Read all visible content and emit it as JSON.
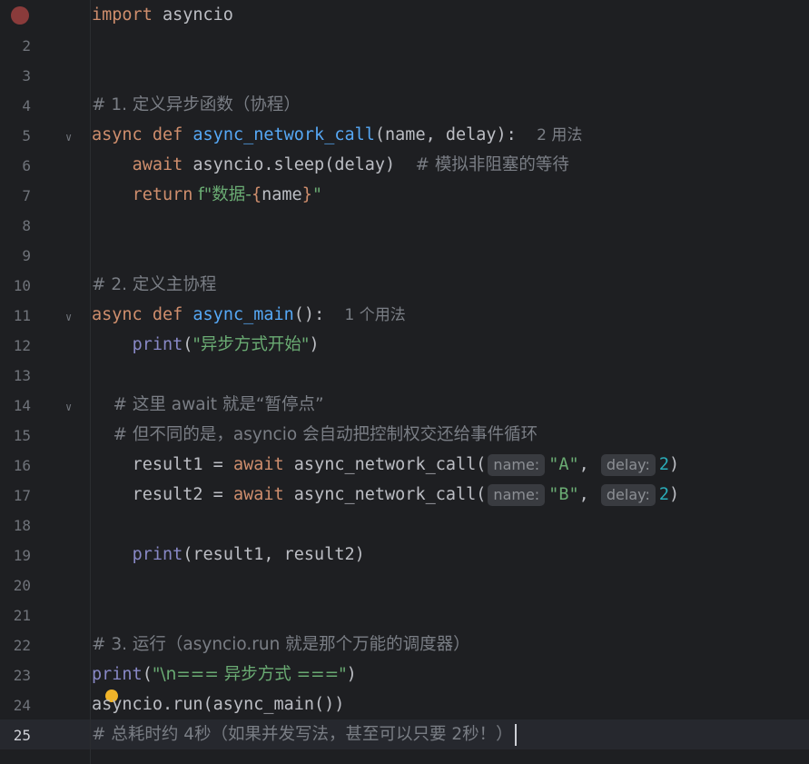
{
  "editor": {
    "current_line": "25",
    "line_numbers": [
      "2",
      "3",
      "4",
      "5",
      "6",
      "7",
      "8",
      "9",
      "10",
      "11",
      "12",
      "13",
      "14",
      "15",
      "16",
      "17",
      "18",
      "19",
      "20",
      "21",
      "22",
      "23",
      "24",
      "25"
    ],
    "lines": {
      "l1": {
        "kw": "import",
        "rest": " asyncio"
      },
      "l4": {
        "comment": "# 1. 定义异步函数（协程）"
      },
      "l5": {
        "kw1": "async",
        "kw2": " def ",
        "fn": "async_network_call",
        "rest": "(name, delay):",
        "hint": "2 用法"
      },
      "l6": {
        "indent": "    ",
        "kw": "await",
        "rest": " asyncio.sleep(delay)  ",
        "comment": "# 模拟非阻塞的等待"
      },
      "l7": {
        "indent": "    ",
        "kw": "return",
        "str1": " f\"数据-",
        "brace1": "{",
        "var": "name",
        "brace2": "}",
        "str2": "\""
      },
      "l10": {
        "comment": "# 2. 定义主协程"
      },
      "l11": {
        "kw1": "async",
        "kw2": " def ",
        "fn": "async_main",
        "rest": "():",
        "hint": "1 个用法"
      },
      "l12": {
        "indent": "    ",
        "builtin": "print",
        "p1": "(",
        "str": "\"异步方式开始\"",
        "p2": ")"
      },
      "l14": {
        "indent": "    ",
        "comment": "# 这里 await 就是“暂停点”"
      },
      "l15": {
        "indent": "    ",
        "comment": "# 但不同的是，asyncio 会自动把控制权交还给事件循环"
      },
      "l16": {
        "indent": "    ",
        "a": "result1 = ",
        "kw": "await",
        "b": " async_network_call(",
        "chip1": "name:",
        "str": "\"A\"",
        "comma": ",",
        "chip2": "delay:",
        "num": "2",
        "close": ")"
      },
      "l17": {
        "indent": "    ",
        "a": "result2 = ",
        "kw": "await",
        "b": " async_network_call(",
        "chip1": "name:",
        "str": "\"B\"",
        "comma": ",",
        "chip2": "delay:",
        "num": "2",
        "close": ")"
      },
      "l19": {
        "indent": "    ",
        "builtin": "print",
        "rest": "(result1, result2)"
      },
      "l22": {
        "comment": "# 3. 运行（asyncio.run 就是那个万能的调度器）"
      },
      "l23": {
        "builtin": "print",
        "p1": "(",
        "str": "\"\\n=== 异步方式 ===\"",
        "p2": ")"
      },
      "l24": {
        "rest": "asyncio.run(async_main())"
      },
      "l25": {
        "comment": "# 总耗时约 4秒（如果并发写法，甚至可以只要 2秒！）"
      }
    }
  },
  "colors": {
    "background": "#1e1f22",
    "keyword": "#cf8e6d",
    "function": "#56a8f5",
    "string": "#6aab73",
    "comment": "#7a7e85",
    "builtin": "#8888c6",
    "number": "#2aacb8"
  },
  "icons": [
    "breakpoint-icon",
    "fold-arrow-icon",
    "lightbulb-icon",
    "text-caret"
  ]
}
